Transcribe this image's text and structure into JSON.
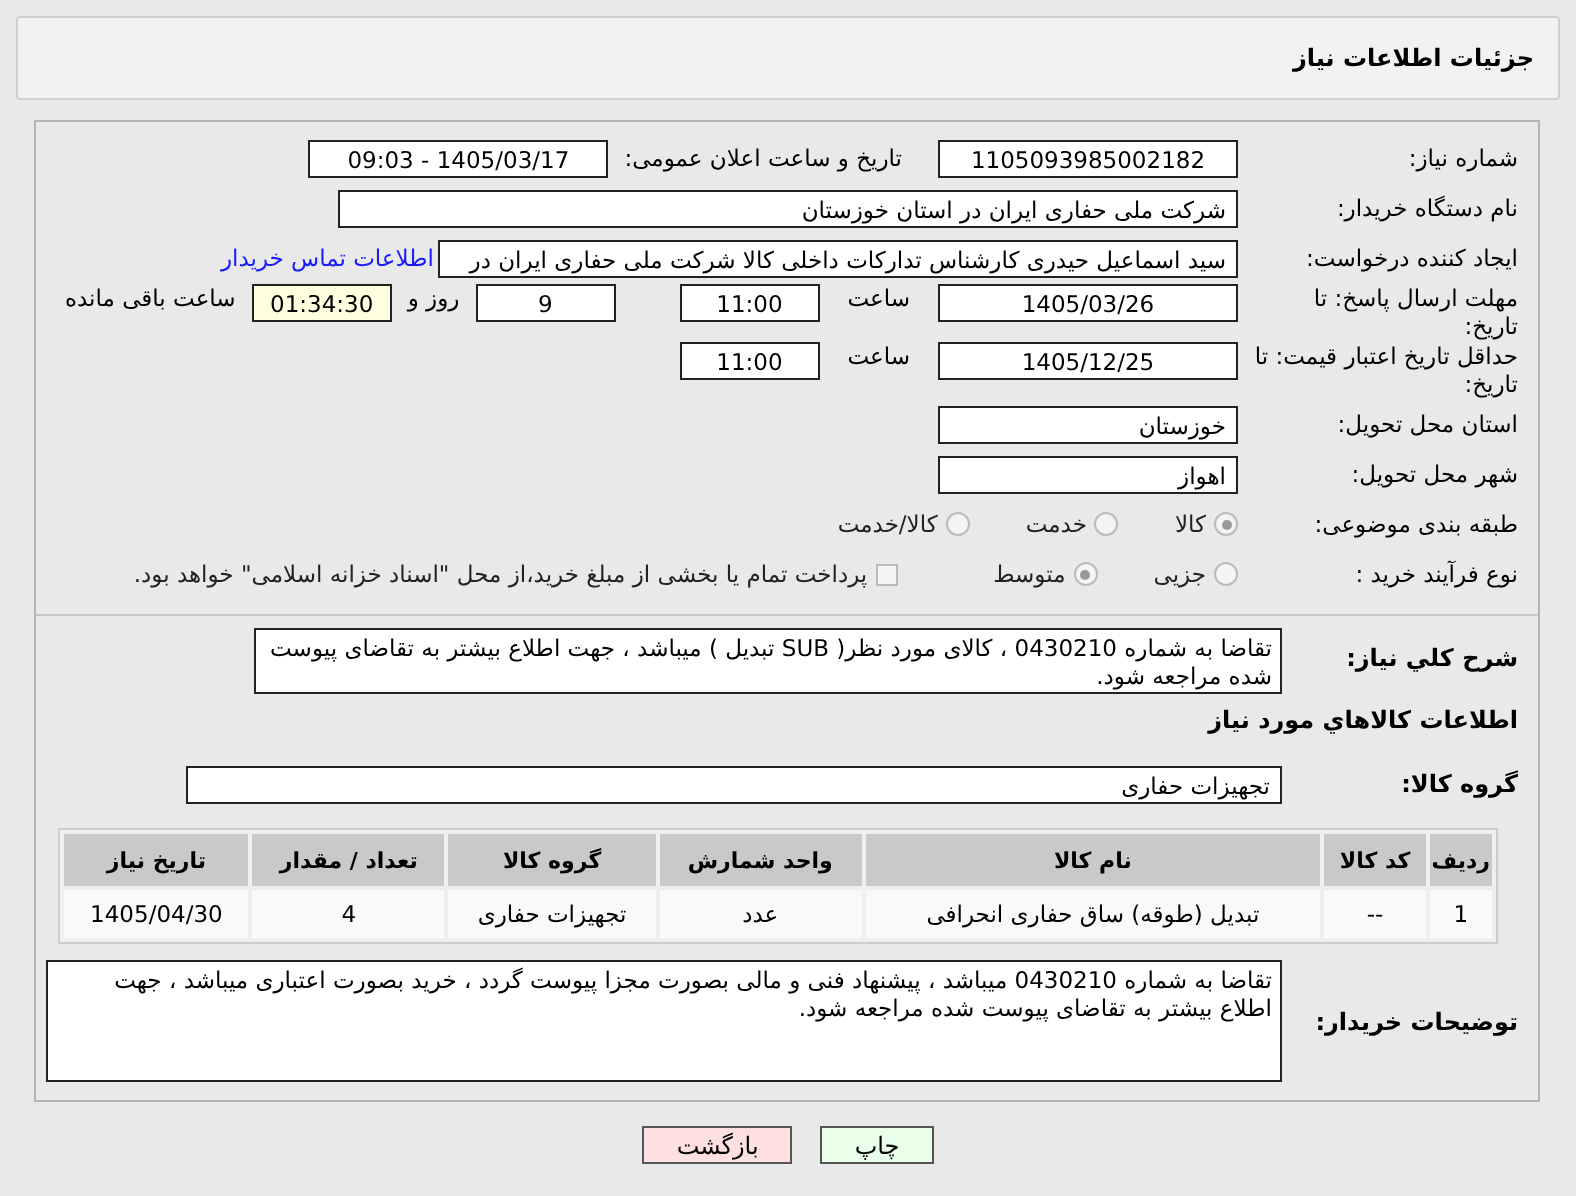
{
  "header": {
    "title": "جزئیات اطلاعات نیاز"
  },
  "need_number": {
    "label": "شماره نیاز:",
    "value": "1105093985002182"
  },
  "announce": {
    "label": "تاریخ و ساعت اعلان عمومی:",
    "value": "1405/03/17 - 09:03"
  },
  "buyer_org": {
    "label": "نام دستگاه خریدار:",
    "value": "شرکت ملی حفاری ایران در استان خوزستان"
  },
  "requester": {
    "label": "ایجاد کننده درخواست:",
    "value": "سید اسماعیل حیدری کارشناس تدارکات داخلی کالا شرکت ملی حفاری ایران در",
    "link": "اطلاعات تماس خریدار"
  },
  "reply_deadline": {
    "label": "مهلت ارسال پاسخ: تا تاریخ:",
    "date": "1405/03/26",
    "time_label": "ساعت",
    "time": "11:00",
    "days": "9",
    "days_label": "روز و",
    "remaining": "01:34:30",
    "remaining_label": "ساعت باقی مانده"
  },
  "price_validity": {
    "label": "حداقل تاریخ اعتبار قیمت: تا تاریخ:",
    "date": "1405/12/25",
    "time_label": "ساعت",
    "time": "11:00"
  },
  "province": {
    "label": "استان محل تحویل:",
    "value": "خوزستان"
  },
  "city": {
    "label": "شهر محل تحویل:",
    "value": "اهواز"
  },
  "category": {
    "label": "طبقه بندی موضوعی:",
    "options": [
      {
        "label": "کالا",
        "selected": true
      },
      {
        "label": "خدمت",
        "selected": false
      },
      {
        "label": "کالا/خدمت",
        "selected": false
      }
    ]
  },
  "purchase_type": {
    "label": "نوع فرآیند خرید :",
    "options": [
      {
        "label": "جزیی",
        "selected": false
      },
      {
        "label": "متوسط",
        "selected": true
      }
    ],
    "treasury": {
      "label": "پرداخت تمام یا بخشی از مبلغ خرید،از محل \"اسناد خزانه اسلامی\" خواهد بود.",
      "checked": false
    }
  },
  "summary": {
    "label": "شرح کلي نياز:",
    "value": "تقاضا به شماره 0430210 ، کالای مورد نظر( SUB  تبدیل ) میباشد ، جهت اطلاع بیشتر به تقاضای پیوست شده مراجعه شود."
  },
  "goods_section": {
    "title": "اطلاعات کالاهاي مورد نياز"
  },
  "goods_group": {
    "label": "گروه کالا:",
    "value": "تجهیزات حفاری"
  },
  "table": {
    "columns": [
      "ردیف",
      "کد کالا",
      "نام کالا",
      "واحد شمارش",
      "گروه کالا",
      "تعداد / مقدار",
      "تاریخ نیاز"
    ],
    "rows": [
      [
        "1",
        "--",
        "تبدیل (طوقه) ساق حفاری انحرافی",
        "عدد",
        "تجهیزات حفاری",
        "4",
        "1405/04/30"
      ]
    ]
  },
  "buyer_notes": {
    "label": "توضیحات خریدار:",
    "value": "تقاضا به شماره 0430210 میباشد ، پیشنهاد فنی و مالی بصورت مجزا پیوست گردد ، خرید بصورت اعتباری میباشد ، جهت اطلاع بیشتر به تقاضای پیوست شده مراجعه شود."
  },
  "buttons": [
    {
      "label": "چاپ",
      "kind": "print"
    },
    {
      "label": "بازگشت",
      "kind": "back"
    }
  ]
}
